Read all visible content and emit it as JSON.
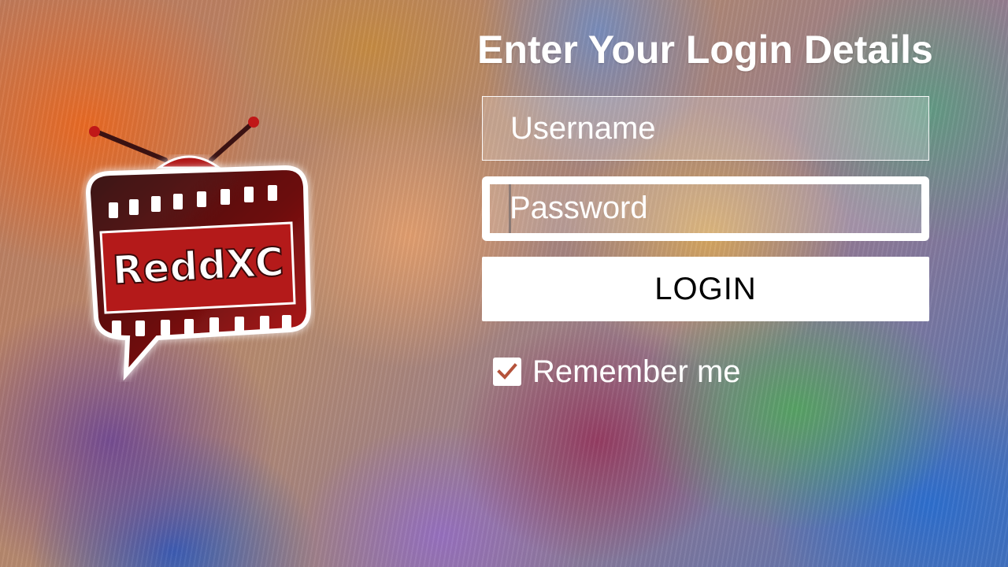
{
  "login": {
    "title": "Enter Your Login Details",
    "username_placeholder": "Username",
    "password_placeholder": "Password",
    "login_button_label": "LOGIN",
    "remember_me_label": "Remember me",
    "remember_me_checked": true
  },
  "logo": {
    "brand_text": "ReddXC",
    "icon": "tv-film-icon"
  },
  "colors": {
    "logo_red": "#b01818",
    "logo_dark": "#2a1010",
    "field_border": "#ffffff",
    "button_background": "#ffffff",
    "text": "#ffffff"
  }
}
